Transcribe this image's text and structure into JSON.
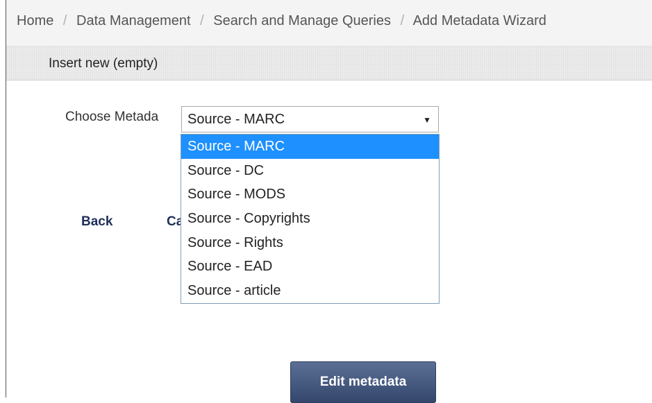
{
  "breadcrumb": {
    "items": [
      "Home",
      "Data Management",
      "Search and Manage Queries",
      "Add Metadata Wizard"
    ],
    "separator": "/"
  },
  "section": {
    "title": "Insert new (empty)"
  },
  "form": {
    "metadata_label": "Choose Metada",
    "select_value": "Source - MARC",
    "options": [
      "Source - MARC",
      "Source - DC",
      "Source - MODS",
      "Source - Copyrights",
      "Source - Rights",
      "Source - EAD",
      "Source - article"
    ],
    "selected_index": 0
  },
  "actions": {
    "back_label": "Back",
    "cancel_label": "Ca",
    "edit_label": "Edit metadata"
  },
  "colors": {
    "highlight": "#1e90ff",
    "link": "#1f2f5a",
    "button": "#3f5279"
  }
}
